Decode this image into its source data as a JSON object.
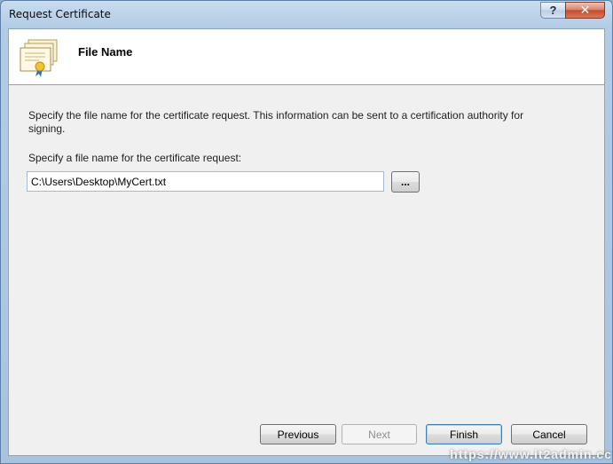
{
  "window": {
    "title": "Request Certificate",
    "help_label": "?",
    "close_label": "✕",
    "background_text": "ᐧᐧᐧᐧᐧᐧ    ᐧᐧᐧᐧᐧᐧ"
  },
  "header": {
    "title": "File Name",
    "icon": "certificate-icon"
  },
  "content": {
    "description": "Specify the file name for the certificate request. This information can be sent to a certification authority for signing.",
    "field_label": "Specify a file name for the certificate request:",
    "filename_value": "C:\\Users\\Desktop\\MyCert.txt",
    "browse_label": "..."
  },
  "footer": {
    "previous_label": "Previous",
    "next_label": "Next",
    "finish_label": "Finish",
    "cancel_label": "Cancel",
    "next_enabled": false
  },
  "watermark": "https://www.it2admin.cc",
  "colors": {
    "accent": "#3c7fb1",
    "close_button": "#c7482b",
    "frame": "#b3cbe4"
  }
}
